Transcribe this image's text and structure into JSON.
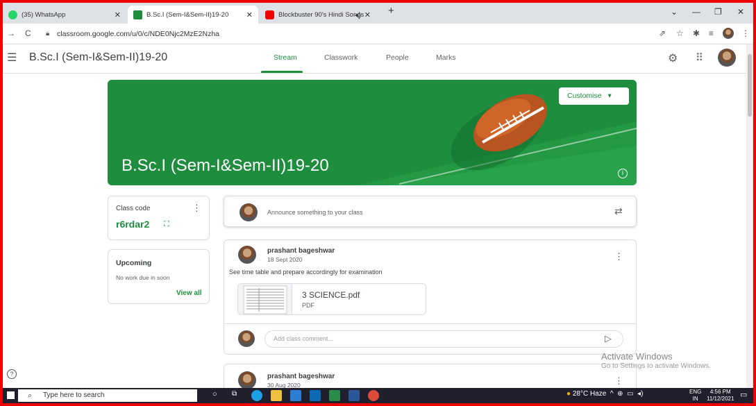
{
  "browser": {
    "tabs": [
      {
        "label": "(35) WhatsApp"
      },
      {
        "label": "B.Sc.I (Sem-I&Sem-II)19-20"
      },
      {
        "label": "Blockbuster 90's Hindi Songs"
      }
    ],
    "url": "classroom.google.com/u/0/c/NDE0Njc2MzE2Nzha"
  },
  "header": {
    "class_title": "B.Sc.I (Sem-I&Sem-II)19-20",
    "tabs": [
      "Stream",
      "Classwork",
      "People",
      "Marks"
    ]
  },
  "banner": {
    "title": "B.Sc.I (Sem-I&Sem-II)19-20",
    "customise_label": "Customise"
  },
  "class_code": {
    "label": "Class code",
    "value": "r6rdar2"
  },
  "upcoming": {
    "label": "Upcoming",
    "text": "No work due in soon",
    "view_all": "View all"
  },
  "announce": {
    "placeholder": "Announce something to your class"
  },
  "posts": [
    {
      "author": "prashant bageshwar",
      "date": "18 Sept 2020",
      "text": "See time table and prepare accordingly for examination",
      "attachment": {
        "name": "3 SCIENCE.pdf",
        "type": "PDF"
      },
      "comment_placeholder": "Add class comment..."
    },
    {
      "author": "prashant bageshwar",
      "date": "30 Aug 2020"
    }
  ],
  "watermark": {
    "line1": "Activate Windows",
    "line2": "Go to Settings to activate Windows."
  },
  "taskbar": {
    "search": "Type here to search",
    "weather": "28°C  Haze",
    "lang": "ENG",
    "lang2": "IN",
    "time": "4:56 PM",
    "date": "11/12/2021"
  }
}
